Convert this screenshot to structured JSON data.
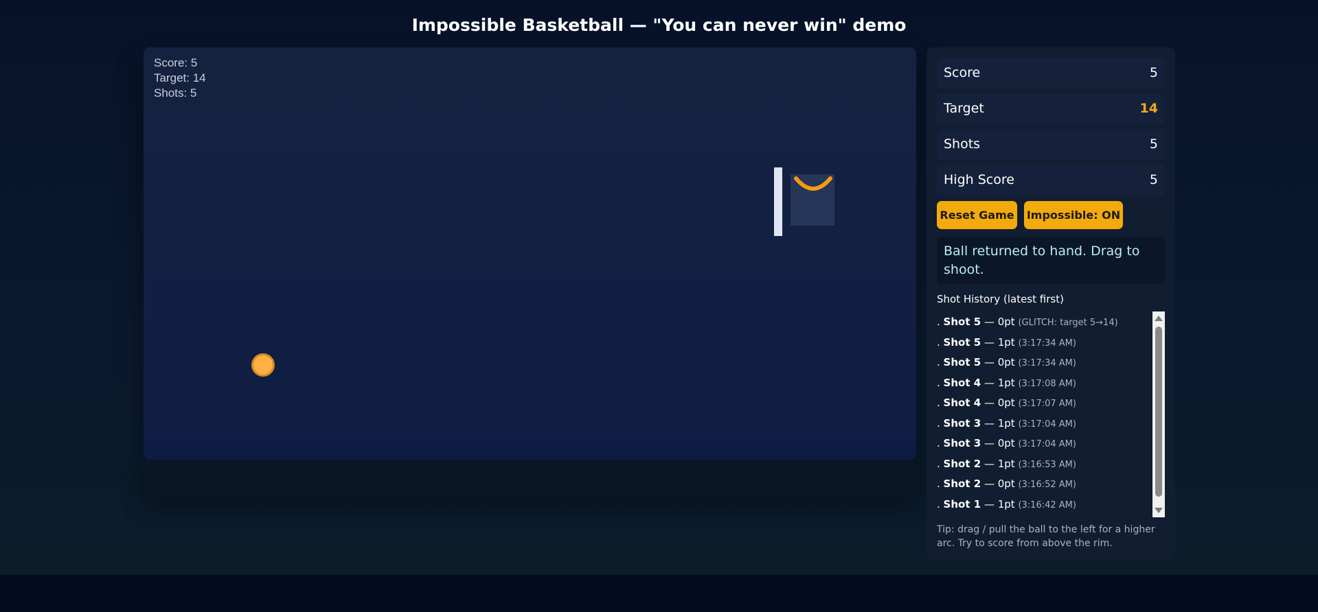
{
  "title": "Impossible Basketball — \"You can never win\" demo",
  "hud": {
    "score": "Score: 5",
    "target": "Target: 14",
    "shots": "Shots: 5"
  },
  "stats": {
    "score": {
      "label": "Score",
      "value": "5"
    },
    "target": {
      "label": "Target",
      "value": "14"
    },
    "shots": {
      "label": "Shots",
      "value": "5"
    },
    "high_score": {
      "label": "High Score",
      "value": "5"
    }
  },
  "buttons": {
    "reset": "Reset Game",
    "impossible": "Impossible: ON"
  },
  "message": "Ball returned to hand. Drag to shoot.",
  "history": {
    "title": "Shot History (latest first)",
    "items": [
      {
        "shot": "Shot 5",
        "points": "0pt",
        "meta": "(GLITCH: target 5→14)"
      },
      {
        "shot": "Shot 5",
        "points": "1pt",
        "meta": "(3:17:34 AM)"
      },
      {
        "shot": "Shot 5",
        "points": "0pt",
        "meta": "(3:17:34 AM)"
      },
      {
        "shot": "Shot 4",
        "points": "1pt",
        "meta": "(3:17:08 AM)"
      },
      {
        "shot": "Shot 4",
        "points": "0pt",
        "meta": "(3:17:07 AM)"
      },
      {
        "shot": "Shot 3",
        "points": "1pt",
        "meta": "(3:17:04 AM)"
      },
      {
        "shot": "Shot 3",
        "points": "0pt",
        "meta": "(3:17:04 AM)"
      },
      {
        "shot": "Shot 2",
        "points": "1pt",
        "meta": "(3:16:53 AM)"
      },
      {
        "shot": "Shot 2",
        "points": "0pt",
        "meta": "(3:16:52 AM)"
      },
      {
        "shot": "Shot 1",
        "points": "1pt",
        "meta": "(3:16:42 AM)"
      }
    ]
  },
  "tip": "Tip: drag / pull the ball to the left for a higher arc. Try to score from above the rim.",
  "colors": {
    "accent": "#f3aa0c",
    "ball": "#ffb043",
    "rim": "#f59a14",
    "message_text": "#b7ecfa"
  }
}
